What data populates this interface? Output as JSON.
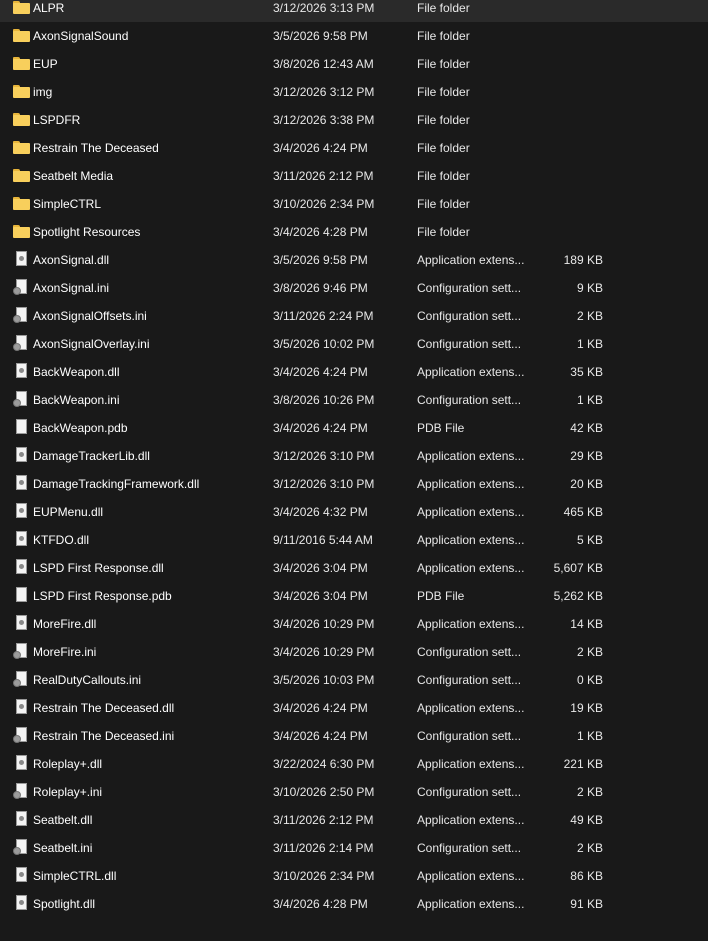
{
  "files": [
    {
      "name": "ALPR",
      "date": "3/12/2026 3:13 PM",
      "type": "File folder",
      "size": "",
      "icon": "folder"
    },
    {
      "name": "AxonSignalSound",
      "date": "3/5/2026 9:58 PM",
      "type": "File folder",
      "size": "",
      "icon": "folder"
    },
    {
      "name": "EUP",
      "date": "3/8/2026 12:43 AM",
      "type": "File folder",
      "size": "",
      "icon": "folder"
    },
    {
      "name": "img",
      "date": "3/12/2026 3:12 PM",
      "type": "File folder",
      "size": "",
      "icon": "folder"
    },
    {
      "name": "LSPDFR",
      "date": "3/12/2026 3:38 PM",
      "type": "File folder",
      "size": "",
      "icon": "folder"
    },
    {
      "name": "Restrain The Deceased",
      "date": "3/4/2026 4:24 PM",
      "type": "File folder",
      "size": "",
      "icon": "folder"
    },
    {
      "name": "Seatbelt Media",
      "date": "3/11/2026 2:12 PM",
      "type": "File folder",
      "size": "",
      "icon": "folder"
    },
    {
      "name": "SimpleCTRL",
      "date": "3/10/2026 2:34 PM",
      "type": "File folder",
      "size": "",
      "icon": "folder"
    },
    {
      "name": "Spotlight Resources",
      "date": "3/4/2026 4:28 PM",
      "type": "File folder",
      "size": "",
      "icon": "folder"
    },
    {
      "name": "AxonSignal.dll",
      "date": "3/5/2026 9:58 PM",
      "type": "Application extens...",
      "size": "189 KB",
      "icon": "dll"
    },
    {
      "name": "AxonSignal.ini",
      "date": "3/8/2026 9:46 PM",
      "type": "Configuration sett...",
      "size": "9 KB",
      "icon": "ini"
    },
    {
      "name": "AxonSignalOffsets.ini",
      "date": "3/11/2026 2:24 PM",
      "type": "Configuration sett...",
      "size": "2 KB",
      "icon": "ini"
    },
    {
      "name": "AxonSignalOverlay.ini",
      "date": "3/5/2026 10:02 PM",
      "type": "Configuration sett...",
      "size": "1 KB",
      "icon": "ini"
    },
    {
      "name": "BackWeapon.dll",
      "date": "3/4/2026 4:24 PM",
      "type": "Application extens...",
      "size": "35 KB",
      "icon": "dll"
    },
    {
      "name": "BackWeapon.ini",
      "date": "3/8/2026 10:26 PM",
      "type": "Configuration sett...",
      "size": "1 KB",
      "icon": "ini"
    },
    {
      "name": "BackWeapon.pdb",
      "date": "3/4/2026 4:24 PM",
      "type": "PDB File",
      "size": "42 KB",
      "icon": "file"
    },
    {
      "name": "DamageTrackerLib.dll",
      "date": "3/12/2026 3:10 PM",
      "type": "Application extens...",
      "size": "29 KB",
      "icon": "dll"
    },
    {
      "name": "DamageTrackingFramework.dll",
      "date": "3/12/2026 3:10 PM",
      "type": "Application extens...",
      "size": "20 KB",
      "icon": "dll"
    },
    {
      "name": "EUPMenu.dll",
      "date": "3/4/2026 4:32 PM",
      "type": "Application extens...",
      "size": "465 KB",
      "icon": "dll"
    },
    {
      "name": "KTFDO.dll",
      "date": "9/11/2016 5:44 AM",
      "type": "Application extens...",
      "size": "5 KB",
      "icon": "dll"
    },
    {
      "name": "LSPD First Response.dll",
      "date": "3/4/2026 3:04 PM",
      "type": "Application extens...",
      "size": "5,607 KB",
      "icon": "dll"
    },
    {
      "name": "LSPD First Response.pdb",
      "date": "3/4/2026 3:04 PM",
      "type": "PDB File",
      "size": "5,262 KB",
      "icon": "file"
    },
    {
      "name": "MoreFire.dll",
      "date": "3/4/2026 10:29 PM",
      "type": "Application extens...",
      "size": "14 KB",
      "icon": "dll"
    },
    {
      "name": "MoreFire.ini",
      "date": "3/4/2026 10:29 PM",
      "type": "Configuration sett...",
      "size": "2 KB",
      "icon": "ini"
    },
    {
      "name": "RealDutyCallouts.ini",
      "date": "3/5/2026 10:03 PM",
      "type": "Configuration sett...",
      "size": "0 KB",
      "icon": "ini"
    },
    {
      "name": "Restrain The Deceased.dll",
      "date": "3/4/2026 4:24 PM",
      "type": "Application extens...",
      "size": "19 KB",
      "icon": "dll"
    },
    {
      "name": "Restrain The Deceased.ini",
      "date": "3/4/2026 4:24 PM",
      "type": "Configuration sett...",
      "size": "1 KB",
      "icon": "ini"
    },
    {
      "name": "Roleplay+.dll",
      "date": "3/22/2024 6:30 PM",
      "type": "Application extens...",
      "size": "221 KB",
      "icon": "dll"
    },
    {
      "name": "Roleplay+.ini",
      "date": "3/10/2026 2:50 PM",
      "type": "Configuration sett...",
      "size": "2 KB",
      "icon": "ini"
    },
    {
      "name": "Seatbelt.dll",
      "date": "3/11/2026 2:12 PM",
      "type": "Application extens...",
      "size": "49 KB",
      "icon": "dll"
    },
    {
      "name": "Seatbelt.ini",
      "date": "3/11/2026 2:14 PM",
      "type": "Configuration sett...",
      "size": "2 KB",
      "icon": "ini"
    },
    {
      "name": "SimpleCTRL.dll",
      "date": "3/10/2026 2:34 PM",
      "type": "Application extens...",
      "size": "86 KB",
      "icon": "dll"
    },
    {
      "name": "Spotlight.dll",
      "date": "3/4/2026 4:28 PM",
      "type": "Application extens...",
      "size": "91 KB",
      "icon": "dll"
    }
  ]
}
